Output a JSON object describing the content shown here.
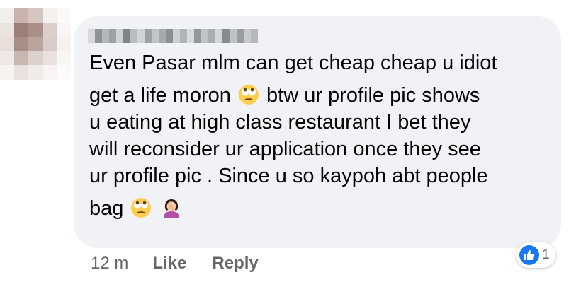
{
  "comment": {
    "lines": [
      "Even Pasar mlm can get cheap cheap u idiot",
      "get a life moron",
      "btw ur profile pic shows",
      "u eating at high class restaurant I bet they",
      "will reconsider ur application once they see",
      "ur profile pic . Since u so kaypoh abt people",
      "bag"
    ],
    "emojis": [
      "eye-roll-emoji",
      "eye-roll-emoji",
      "facepalm-woman-emoji"
    ]
  },
  "footer": {
    "timestamp": "12 m",
    "like_label": "Like",
    "reply_label": "Reply"
  },
  "reaction": {
    "icon": "thumbs-up-icon",
    "count": "1",
    "color": "#1877f2"
  },
  "colors": {
    "bubble": "#f0f2f5",
    "text": "#050505",
    "muted": "#65676b"
  }
}
